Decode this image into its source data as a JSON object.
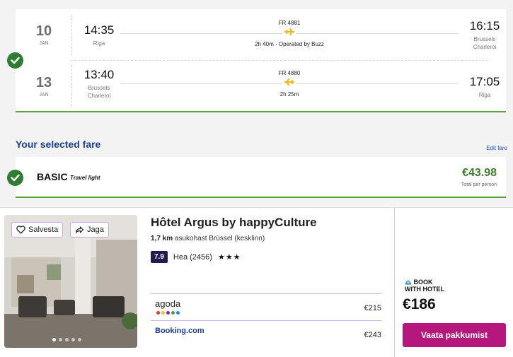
{
  "flight": {
    "outbound": {
      "day": "10",
      "month": "JAN",
      "dep_time": "14:35",
      "dep_place": "Riga",
      "flight_no": "FR 4881",
      "info": "2h 40m · Operated by Buzz",
      "arr_time": "16:15",
      "arr_place_line1": "Brussels",
      "arr_place_line2": "Charleroi"
    },
    "return": {
      "day": "13",
      "month": "JAN",
      "dep_time": "13:40",
      "dep_place_line1": "Brussels",
      "dep_place_line2": "Charleroi",
      "flight_no": "FR 4880",
      "info": "2h 25m",
      "arr_time": "17:05",
      "arr_place": "Riga"
    }
  },
  "fare": {
    "section_title": "Your selected fare",
    "edit_link": "Edit fare",
    "name": "BASIC",
    "subtitle": "Travel light",
    "price": "€43.98",
    "price_note": "Total per person"
  },
  "hotel": {
    "save_label": "Salvesta",
    "share_label": "Jaga",
    "name": "Hôtel Argus by happyCulture",
    "distance_bold": "1,7 km",
    "distance_rest": "asukohast Brüssel (kesklinn)",
    "rating_score": "7.9",
    "rating_text": "Hea (2456)",
    "stars": "★★★",
    "providers": [
      {
        "name": "agoda",
        "price": "€215"
      },
      {
        "name": "Booking.com",
        "price": "€243"
      }
    ],
    "book_badge_line1": "BOOK",
    "book_badge_line2": "WITH HOTEL",
    "best_price": "€186",
    "cta_label": "Vaata pakkumist",
    "photo_dots": 5
  },
  "colors": {
    "check_green": "#2e7d32",
    "price_green": "#3c7d2a",
    "link_blue": "#1a56b8",
    "title_blue": "#1a3f8e",
    "cta_magenta": "#b5177d",
    "rating_navy": "#231a4f"
  }
}
